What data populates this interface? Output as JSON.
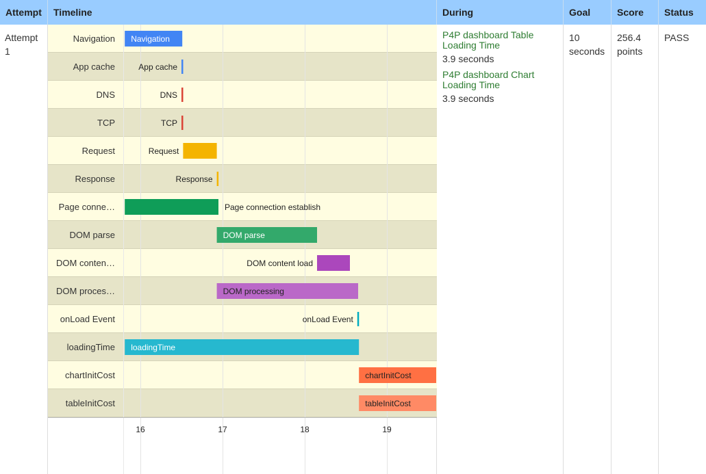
{
  "headers": {
    "attempt": "Attempt",
    "timeline": "Timeline",
    "during": "During",
    "goal": "Goal",
    "score": "Score",
    "status": "Status"
  },
  "row": {
    "attempt": "Attempt 1",
    "during": [
      {
        "link": "P4P dashboard Table Loading Time",
        "value": "3.9 seconds"
      },
      {
        "link": "P4P dashboard Chart Loading Time",
        "value": "3.9 seconds"
      }
    ],
    "goal": "10 seconds",
    "score": "256.4 points",
    "status": "PASS"
  },
  "chart_data": {
    "type": "timeline",
    "x_ticks": [
      16,
      17,
      18,
      19
    ],
    "xlim": [
      15.8,
      19.6
    ],
    "rows": [
      {
        "label": "Navigation",
        "bar_label": "Navigation",
        "start": 15.81,
        "end": 16.51,
        "color": "#4285f4",
        "label_inside": true,
        "text_color": "#ffffff"
      },
      {
        "label": "App cache",
        "bar_label": "App cache",
        "start": 16.5,
        "end": 16.52,
        "color": "#4285f4",
        "label_inside": false
      },
      {
        "label": "DNS",
        "bar_label": "DNS",
        "start": 16.5,
        "end": 16.52,
        "color": "#db4437",
        "label_inside": false
      },
      {
        "label": "TCP",
        "bar_label": "TCP",
        "start": 16.5,
        "end": 16.52,
        "color": "#db4437",
        "label_inside": false
      },
      {
        "label": "Request",
        "bar_label": "Request",
        "start": 16.52,
        "end": 16.93,
        "color": "#f4b400",
        "label_inside": false
      },
      {
        "label": "Response",
        "bar_label": "Response",
        "start": 16.93,
        "end": 16.95,
        "color": "#f4b400",
        "label_inside": false
      },
      {
        "label": "Page conne…",
        "bar_label": "Page connection establish",
        "start": 15.81,
        "end": 16.95,
        "color": "#0f9d58",
        "label_inside": false,
        "label_after": true
      },
      {
        "label": "DOM parse",
        "bar_label": "DOM parse",
        "start": 16.93,
        "end": 18.15,
        "color": "#33a96b",
        "label_inside": true,
        "text_color": "#ffffff"
      },
      {
        "label": "DOM conten…",
        "bar_label": "DOM content load",
        "start": 18.15,
        "end": 18.55,
        "color": "#ab47bc",
        "label_inside": false
      },
      {
        "label": "DOM proces…",
        "bar_label": "DOM processing",
        "start": 16.93,
        "end": 18.65,
        "color": "#ba68c8",
        "label_inside": true,
        "text_color": "#222222"
      },
      {
        "label": "onLoad Event",
        "bar_label": "onLoad Event",
        "start": 18.64,
        "end": 18.66,
        "color": "#00acc1",
        "label_inside": false
      },
      {
        "label": "loadingTime",
        "bar_label": "loadingTime",
        "start": 15.81,
        "end": 18.66,
        "color": "#26b8cf",
        "label_inside": true,
        "text_color": "#ffffff"
      },
      {
        "label": "chartInitCost",
        "bar_label": "chartInitCost",
        "start": 18.66,
        "end": 19.6,
        "color": "#ff7043",
        "label_inside": true,
        "text_color": "#222222"
      },
      {
        "label": "tableInitCost",
        "bar_label": "tableInitCost",
        "start": 18.66,
        "end": 19.6,
        "color": "#ff8a65",
        "label_inside": true,
        "text_color": "#222222"
      }
    ]
  }
}
